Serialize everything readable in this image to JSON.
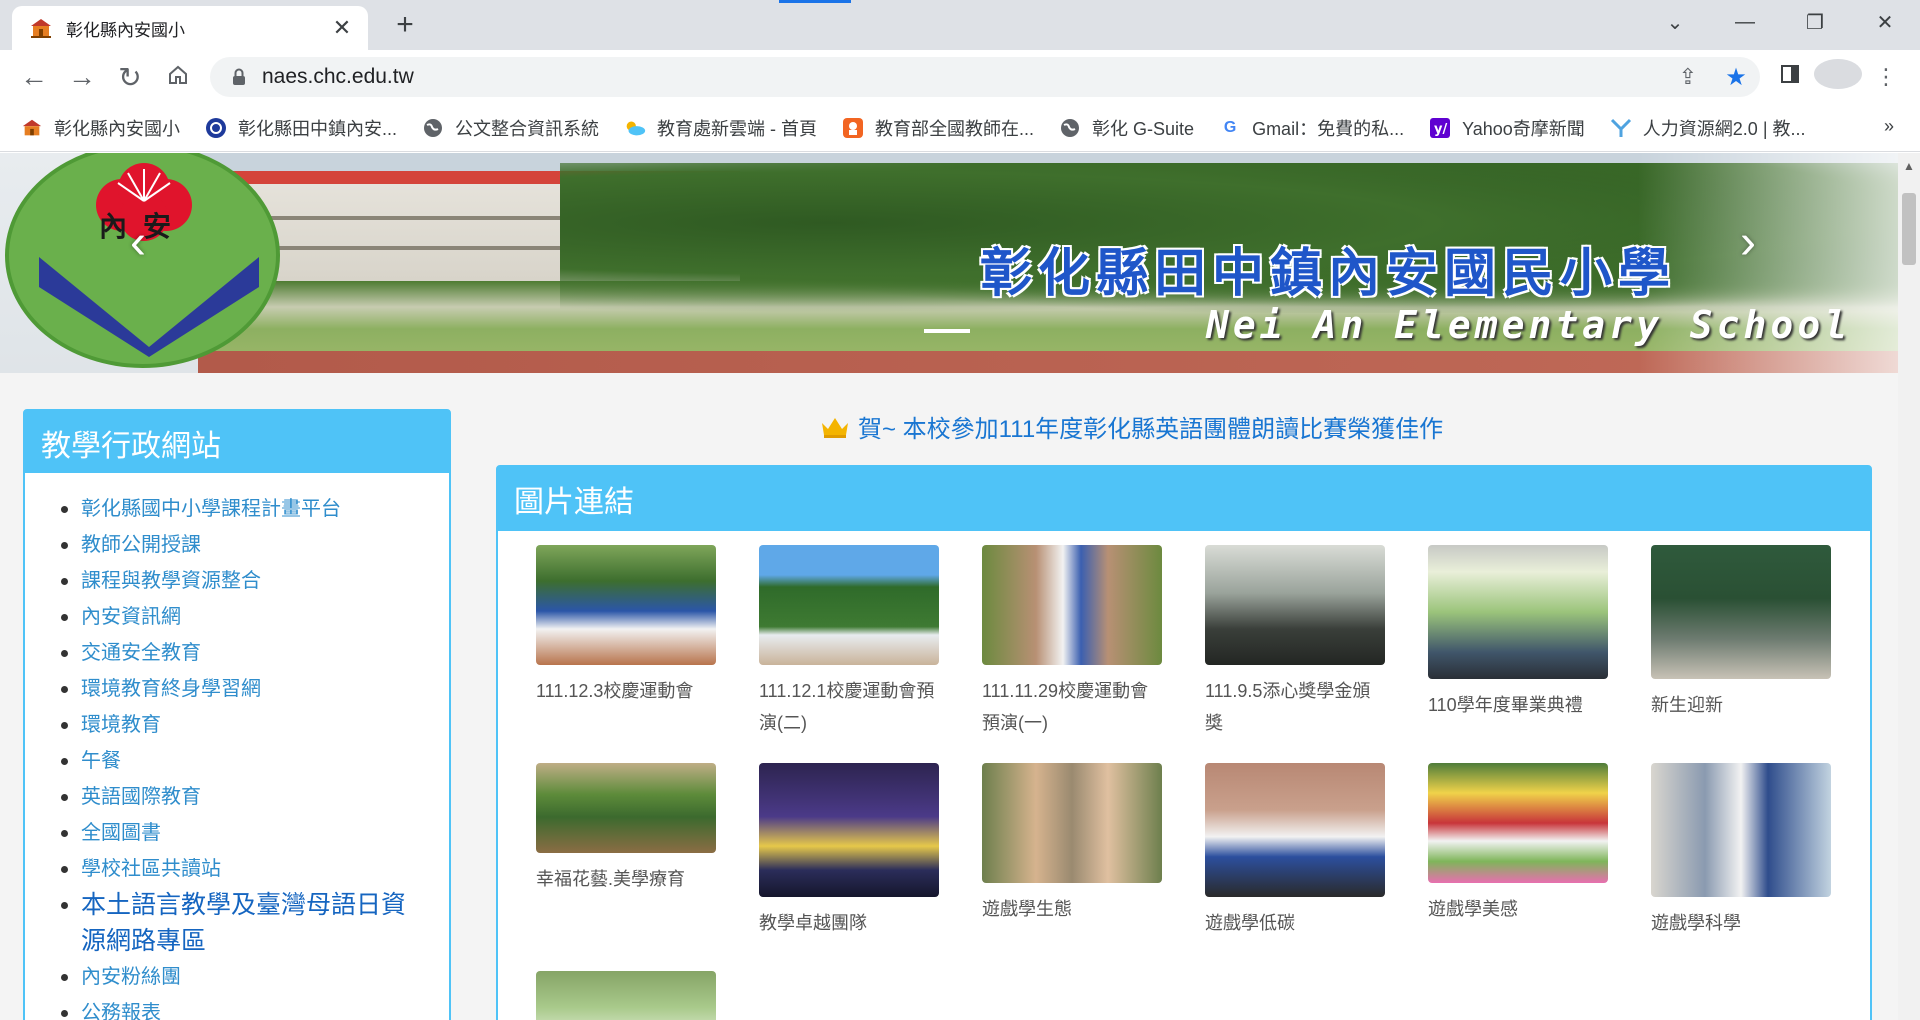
{
  "browser": {
    "tab_title": "彰化縣內安國小",
    "url": "naes.chc.edu.tw",
    "window_controls": [
      "⌄",
      "—",
      "❐",
      "✕"
    ]
  },
  "bookmarks": [
    {
      "label": "彰化縣內安國小",
      "icon": "school-icon"
    },
    {
      "label": "彰化縣田中鎮內安...",
      "icon": "circle-logo-icon"
    },
    {
      "label": "公文整合資訊系統",
      "icon": "globe-icon"
    },
    {
      "label": "教育處新雲端 - 首頁",
      "icon": "cloud-icon"
    },
    {
      "label": "教育部全國教師在...",
      "icon": "orange-app-icon"
    },
    {
      "label": "彰化 G-Suite",
      "icon": "globe-icon"
    },
    {
      "label": "Gmail：免費的私...",
      "icon": "google-icon"
    },
    {
      "label": "Yahoo奇摩新聞",
      "icon": "yahoo-icon"
    },
    {
      "label": "人力資源網2.0 | 教...",
      "icon": "y-logo-icon"
    }
  ],
  "banner": {
    "logo_text": "內安",
    "title_zh": "彰化縣田中鎮內安國民小學",
    "title_en": "Nei An Elementary School"
  },
  "sidebar": {
    "title": "教學行政網站",
    "items": [
      "彰化縣國中小學課程計畫平台",
      "教師公開授課",
      " 課程與教學資源整合",
      "內安資訊網",
      "交通安全教育",
      "環境教育終身學習網",
      "環境教育",
      "午餐",
      "英語國際教育",
      "全國圖書",
      "學校社區共讀站",
      "本土語言教學及臺灣母語日資源網路專區",
      "內安粉絲團",
      "公務報表"
    ]
  },
  "headline": "賀~ 本校參加111年度彰化縣英語團體朗讀比賽榮獲佳作",
  "panel": {
    "title": "圖片連結",
    "cards": [
      {
        "caption": "111.12.3校慶運動會"
      },
      {
        "caption": "111.12.1校慶運動會預演(二)"
      },
      {
        "caption": "111.11.29校慶運動會預演(一)"
      },
      {
        "caption": "111.9.5添心獎學金頒獎"
      },
      {
        "caption": "110學年度畢業典禮"
      },
      {
        "caption": "新生迎新"
      },
      {
        "caption": "幸福花藝.美學療育"
      },
      {
        "caption": "教學卓越團隊"
      },
      {
        "caption": "遊戲學生態"
      },
      {
        "caption": "遊戲學低碳"
      },
      {
        "caption": "遊戲學美感"
      },
      {
        "caption": "遊戲學科學"
      },
      {
        "caption": ""
      }
    ]
  },
  "colors": {
    "accent": "#4fc3f7",
    "link": "#2f8dcc",
    "headline": "#1976d2"
  }
}
